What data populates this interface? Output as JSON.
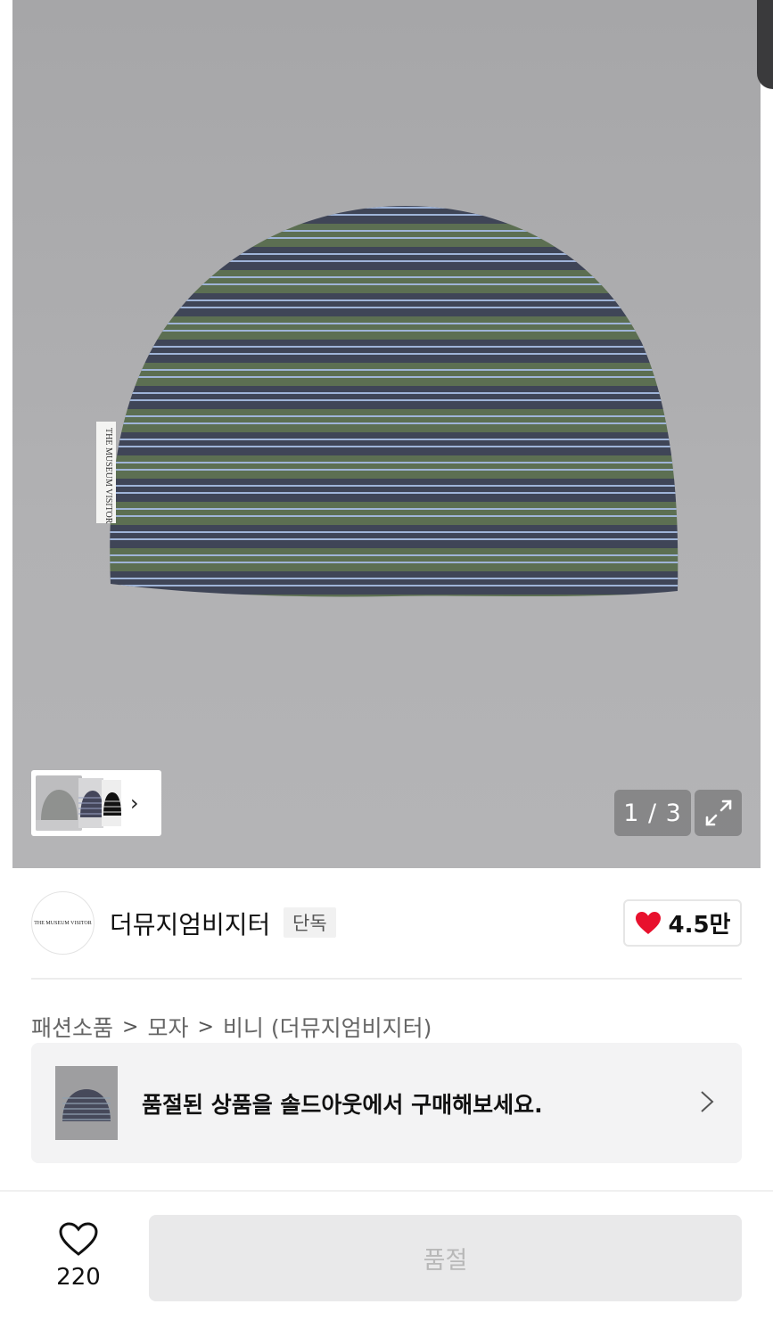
{
  "gallery": {
    "counter": "1 / 3",
    "label_text": "THE MUSEUM VISITOR",
    "expand_icon": "expand-icon",
    "thumb_chevron": "›"
  },
  "brand": {
    "logo_text": "THE MUSEUM VISITOR",
    "name": "더뮤지엄비지터",
    "tag": "단독",
    "likes": "4.5만",
    "heart_color": "#e8112d"
  },
  "breadcrumb": {
    "items": [
      "패션소품",
      "모자",
      "비니 (더뮤지엄비지터)"
    ]
  },
  "soldout_banner": {
    "text": "품절된 상품을 솔드아웃에서 구매해보세요."
  },
  "bottom_bar": {
    "wish_count": "220",
    "buy_label": "품절"
  }
}
